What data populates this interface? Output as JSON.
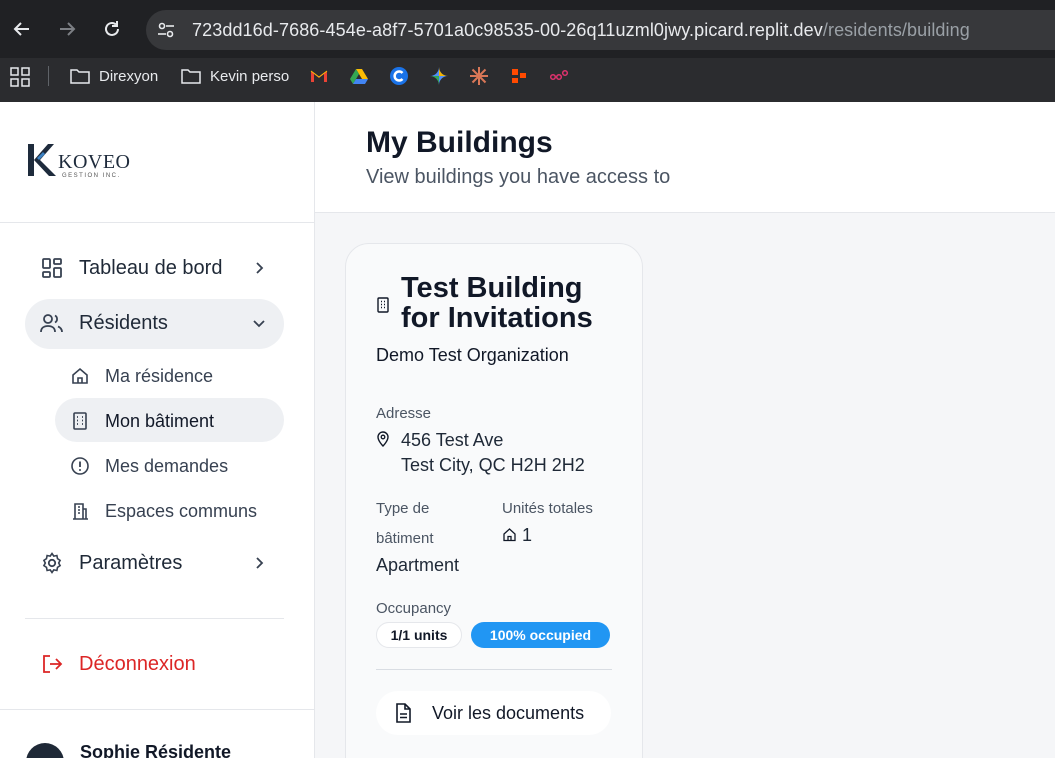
{
  "browser": {
    "url_host": "723dd16d-7686-454e-a8f7-5701a0c98535-00-26q11uzml0jwy.picard.replit.dev",
    "url_path": "/residents/building",
    "bookmarks": [
      "Direxyon",
      "Kevin perso"
    ],
    "bookmark_icons": [
      "gmail-icon",
      "google-drive-icon",
      "c-app-icon",
      "gemini-icon",
      "claude-icon",
      "zapier-icon",
      "make-icon"
    ]
  },
  "sidebar": {
    "logo_name": "KOVEO",
    "logo_sub": "GESTION INC.",
    "items": {
      "dashboard": "Tableau de bord",
      "residents": "Résidents",
      "ma_residence": "Ma résidence",
      "mon_batiment": "Mon bâtiment",
      "mes_demandes": "Mes demandes",
      "espaces_communs": "Espaces communs",
      "parametres": "Paramètres",
      "logout": "Déconnexion"
    },
    "user_name": "Sophie Résidente"
  },
  "main": {
    "title": "My Buildings",
    "subtitle": "View buildings you have access to"
  },
  "building_card": {
    "name": "Test Building for Invitations",
    "organization": "Demo Test Organization",
    "address_label": "Adresse",
    "address_line1": "456 Test Ave",
    "address_line2": "Test City, QC H2H 2H2",
    "type_label_1": "Type de",
    "type_label_2": "bâtiment",
    "type_value": "Apartment",
    "units_label": "Unités totales",
    "units_value": "1",
    "occupancy_label": "Occupancy",
    "occupancy_units": "1/1 units",
    "occupancy_percent": "100% occupied",
    "docs_button": "Voir les documents"
  },
  "colors": {
    "accent": "#2196f3",
    "logout": "#dc2626",
    "chrome_dark": "#202124"
  }
}
